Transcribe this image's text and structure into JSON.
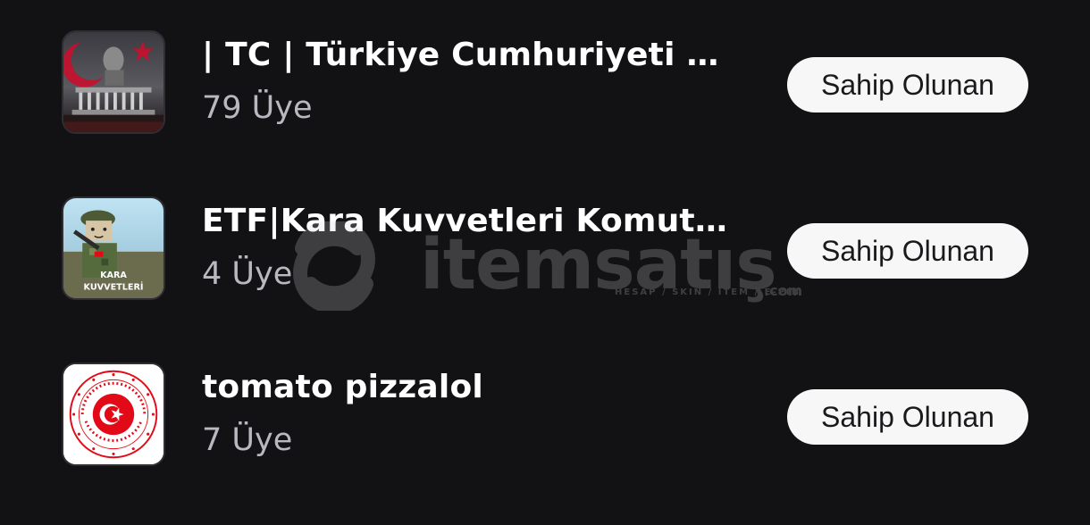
{
  "groups": [
    {
      "name": "| TC | Türkiye Cumhuriyeti Rol...",
      "members": "79 Üye",
      "status_label": "Sahip Olunan",
      "icon": "mausoleum-flag-icon"
    },
    {
      "name": "ETF|Kara Kuvvetleri Komutanlı...",
      "members": "4 Üye",
      "status_label": "Sahip Olunan",
      "icon": "soldier-avatar-icon",
      "icon_caption": "KARA KUVVETLERİ"
    },
    {
      "name": "tomato pizzalol",
      "members": "7 Üye",
      "status_label": "Sahip Olunan",
      "icon": "ministry-seal-icon",
      "icon_caption": "TÜRKİYE CUMHURİYETİ DIŞİŞLERİ BAKANLIĞI"
    }
  ],
  "watermark": {
    "brand": "itemsatış",
    "tagline": "HESAP / SKIN / ITEM / E-PIN",
    "suffix": ".com"
  },
  "colors": {
    "background": "#121215",
    "button_bg": "#f7f7f8",
    "button_text": "#1a1a1d",
    "muted_text": "#b8b8bf",
    "flag_red": "#e30a17"
  }
}
